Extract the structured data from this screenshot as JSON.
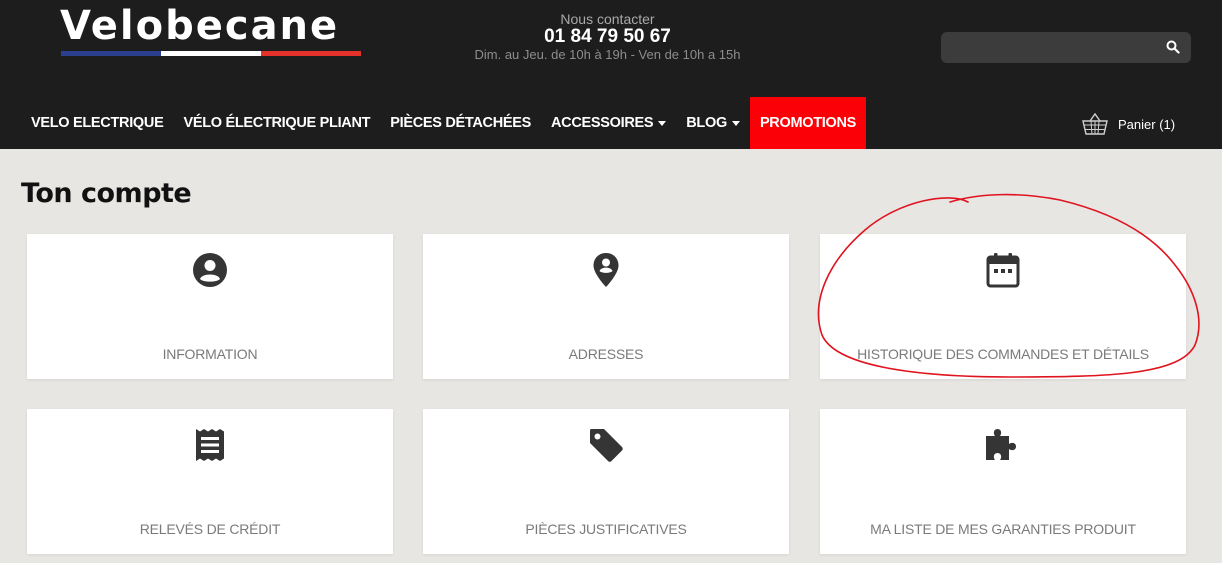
{
  "header": {
    "logo": "Velobecane",
    "contact_label": "Nous contacter",
    "phone": "01 84 79 50 67",
    "hours": "Dim. au Jeu. de 10h à 19h - Ven de 10h a 15h",
    "search": {
      "placeholder": "",
      "icon": "search-icon"
    }
  },
  "nav": {
    "items": [
      {
        "label": "VELO ELECTRIQUE"
      },
      {
        "label": "VÉLO ÉLECTRIQUE PLIANT"
      },
      {
        "label": "PIÈCES DÉTACHÉES"
      },
      {
        "label": "ACCESSOIRES",
        "dropdown": true
      },
      {
        "label": "BLOG",
        "dropdown": true
      },
      {
        "label": "PROMOTIONS",
        "highlight": true
      }
    ],
    "promo_color": "#fb0006",
    "cart_label": "Panier (1)",
    "cart_icon": "basket-icon"
  },
  "page": {
    "title": "Ton compte",
    "tiles": [
      {
        "label": "INFORMATION",
        "icon": "user-circle-icon"
      },
      {
        "label": "ADRESSES",
        "icon": "map-pin-icon"
      },
      {
        "label": "HISTORIQUE DES COMMANDES ET DÉTAILS",
        "icon": "calendar-icon",
        "annotated": true
      },
      {
        "label": "RELEVÉS DE CRÉDIT",
        "icon": "receipt-icon"
      },
      {
        "label": "PIÈCES JUSTIFICATIVES",
        "icon": "tag-icon"
      },
      {
        "label": "MA LISTE DE MES GARANTIES PRODUIT",
        "icon": "puzzle-icon"
      }
    ]
  },
  "colors": {
    "header_bg": "#1d1d1d",
    "page_bg": "#e8e6e3",
    "annotation": "#e0141e"
  }
}
